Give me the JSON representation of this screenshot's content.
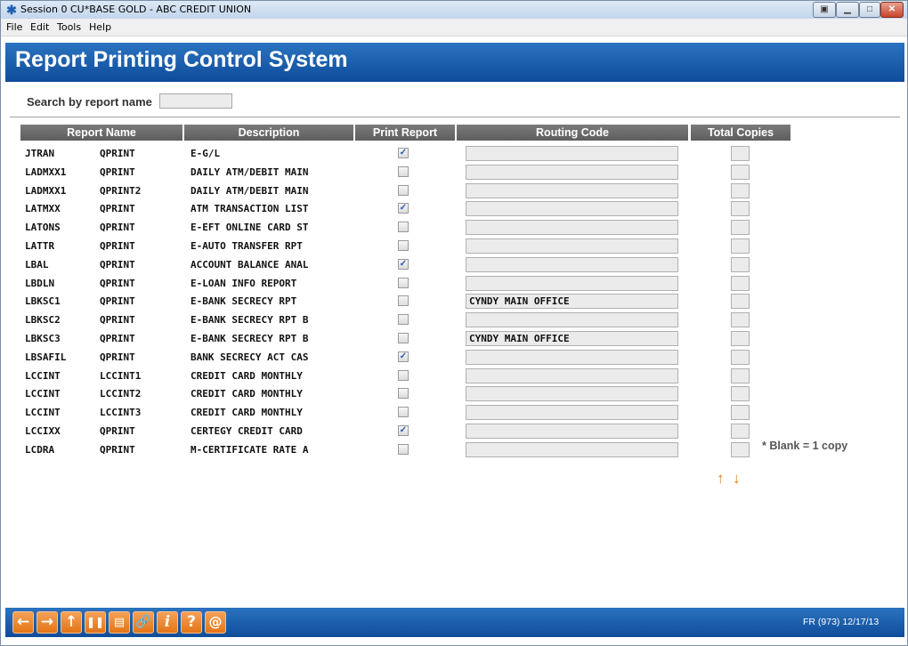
{
  "window": {
    "title": "Session 0 CU*BASE GOLD - ABC CREDIT UNION",
    "app_icon": "sparkle-icon"
  },
  "menu": [
    "File",
    "Edit",
    "Tools",
    "Help"
  ],
  "header": {
    "title": "Report Printing Control System"
  },
  "search": {
    "label": "Search by report name",
    "value": ""
  },
  "columns": [
    "Report Name",
    "Description",
    "Print Report",
    "Routing Code",
    "Total Copies"
  ],
  "rows": [
    {
      "name": "JTRAN",
      "queue": "QPRINT",
      "desc": "E-G/L",
      "print": true,
      "routing": "",
      "copies": ""
    },
    {
      "name": "LADMXX1",
      "queue": "QPRINT",
      "desc": "DAILY ATM/DEBIT MAIN",
      "print": false,
      "routing": "",
      "copies": ""
    },
    {
      "name": "LADMXX1",
      "queue": "QPRINT2",
      "desc": "DAILY ATM/DEBIT MAIN",
      "print": false,
      "routing": "",
      "copies": ""
    },
    {
      "name": "LATMXX",
      "queue": "QPRINT",
      "desc": "ATM TRANSACTION LIST",
      "print": true,
      "routing": "",
      "copies": ""
    },
    {
      "name": "LATONS",
      "queue": "QPRINT",
      "desc": "E-EFT ONLINE CARD ST",
      "print": false,
      "routing": "",
      "copies": ""
    },
    {
      "name": "LATTR",
      "queue": "QPRINT",
      "desc": "E-AUTO TRANSFER RPT",
      "print": false,
      "routing": "",
      "copies": ""
    },
    {
      "name": "LBAL",
      "queue": "QPRINT",
      "desc": "ACCOUNT BALANCE ANAL",
      "print": true,
      "routing": "",
      "copies": ""
    },
    {
      "name": "LBDLN",
      "queue": "QPRINT",
      "desc": "E-LOAN INFO REPORT",
      "print": false,
      "routing": "",
      "copies": ""
    },
    {
      "name": "LBKSC1",
      "queue": "QPRINT",
      "desc": "E-BANK SECRECY RPT",
      "print": false,
      "routing": "CYNDY MAIN OFFICE",
      "copies": ""
    },
    {
      "name": "LBKSC2",
      "queue": "QPRINT",
      "desc": "E-BANK SECRECY RPT B",
      "print": false,
      "routing": "",
      "copies": ""
    },
    {
      "name": "LBKSC3",
      "queue": "QPRINT",
      "desc": "E-BANK SECRECY RPT B",
      "print": false,
      "routing": "CYNDY MAIN OFFICE",
      "copies": ""
    },
    {
      "name": "LBSAFIL",
      "queue": "QPRINT",
      "desc": "BANK SECRECY ACT CAS",
      "print": true,
      "routing": "",
      "copies": ""
    },
    {
      "name": "LCCINT",
      "queue": "LCCINT1",
      "desc": "CREDIT CARD MONTHLY",
      "print": false,
      "routing": "",
      "copies": ""
    },
    {
      "name": "LCCINT",
      "queue": "LCCINT2",
      "desc": "CREDIT CARD MONTHLY",
      "print": false,
      "routing": "",
      "copies": ""
    },
    {
      "name": "LCCINT",
      "queue": "LCCINT3",
      "desc": "CREDIT CARD MONTHLY",
      "print": false,
      "routing": "",
      "copies": ""
    },
    {
      "name": "LCCIXX",
      "queue": "QPRINT",
      "desc": "CERTEGY CREDIT CARD",
      "print": true,
      "routing": "",
      "copies": ""
    },
    {
      "name": "LCDRA",
      "queue": "QPRINT",
      "desc": "M-CERTIFICATE RATE A",
      "print": false,
      "routing": "",
      "copies": ""
    }
  ],
  "note": "* Blank = 1 copy",
  "scroll_arrows": {
    "up": "↑",
    "down": "↓"
  },
  "footer": {
    "buttons": [
      {
        "icon": "back-arrow-icon",
        "glyph": "←"
      },
      {
        "icon": "forward-arrow-icon",
        "glyph": "→"
      },
      {
        "icon": "up-arrow-icon",
        "glyph": "↑"
      },
      {
        "icon": "pause-icon",
        "glyph": "❚❚"
      },
      {
        "icon": "print-icon",
        "glyph": "▤"
      },
      {
        "icon": "link-icon",
        "glyph": "🔗"
      },
      {
        "icon": "info-icon",
        "glyph": "i"
      },
      {
        "icon": "help-icon",
        "glyph": "?"
      },
      {
        "icon": "at-icon",
        "glyph": "@"
      }
    ],
    "screen_id": "FR (973) 12/17/13"
  },
  "colors": {
    "header_blue": "#1a5fae",
    "accent_orange": "#e37414",
    "table_header_gray": "#6a6a6a"
  }
}
